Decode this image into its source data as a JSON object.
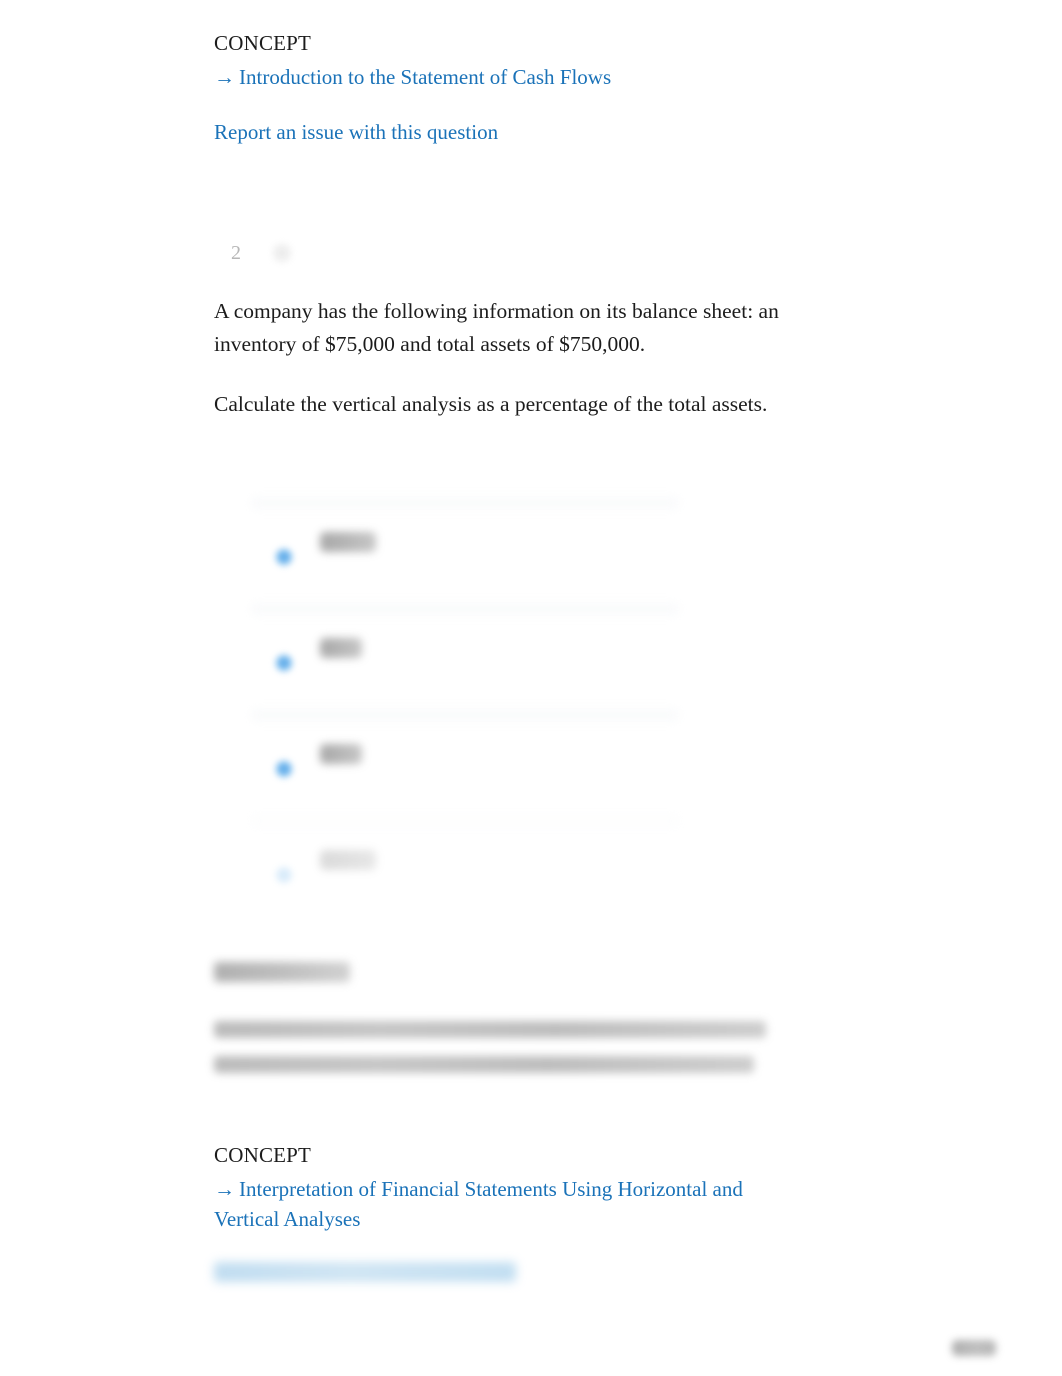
{
  "page": {
    "background": "#ffffff",
    "link_color": "#1a72b8",
    "text_color": "#1c1c1c",
    "muted_color": "#b7b7b7"
  },
  "top_concept": {
    "heading": "CONCEPT",
    "arrow": "→",
    "link_label": "Introduction to the Statement of Cash Flows",
    "report_label": "Report an issue with this question"
  },
  "question": {
    "number": "2",
    "icon": "question-status-icon",
    "paragraph_1": "A company has the following information on its balance sheet: an inventory of $75,000 and total assets of $750,000.",
    "paragraph_2": "Calculate the vertical analysis as a percentage of the total assets.",
    "options": [
      {
        "id": "option-a",
        "label": "",
        "selected": false,
        "obscured": true
      },
      {
        "id": "option-b",
        "label": "",
        "selected": false,
        "obscured": true
      },
      {
        "id": "option-c",
        "label": "",
        "selected": false,
        "obscured": true
      },
      {
        "id": "option-d",
        "label": "",
        "selected": false,
        "obscured": true
      }
    ]
  },
  "rationale": {
    "heading": "",
    "line_1": "",
    "line_2": "",
    "obscured": true
  },
  "bottom_concept": {
    "heading": "CONCEPT",
    "arrow": "→",
    "link_label": "Interpretation of Financial Statements Using Horizontal and Vertical Analyses",
    "report_label": "",
    "report_obscured": true
  },
  "corner_badge": {
    "label": "",
    "obscured": true
  }
}
